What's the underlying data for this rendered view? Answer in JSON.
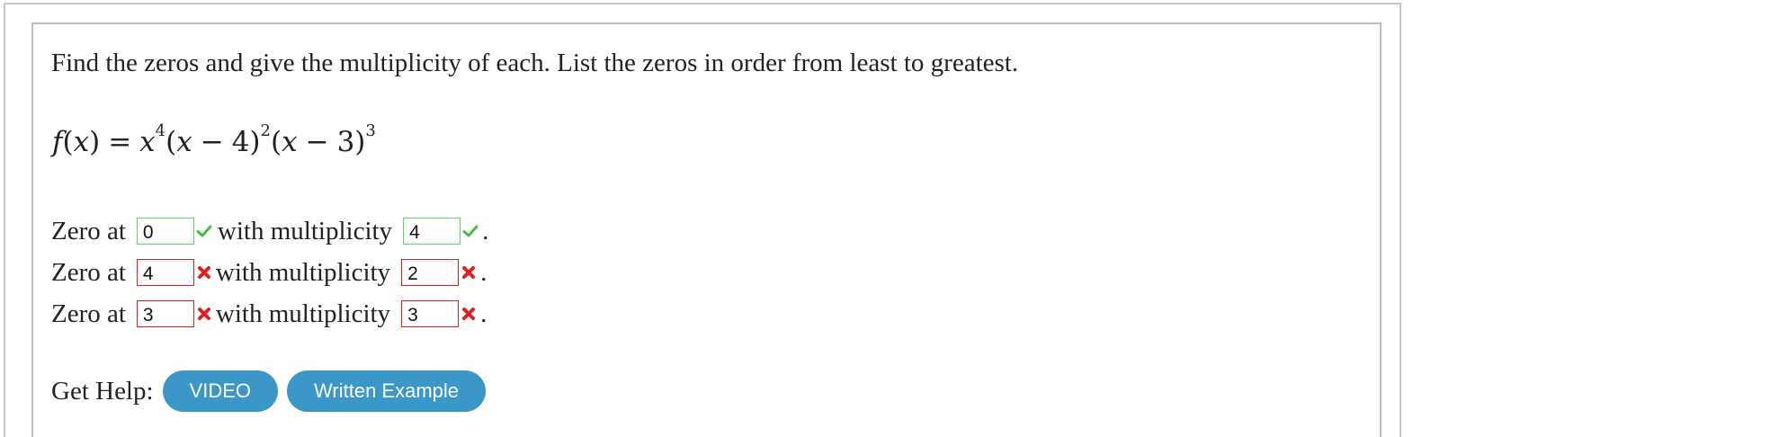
{
  "question": {
    "prompt": "Find the zeros and give the multiplicity of each. List the zeros in order from least to greatest.",
    "formula": {
      "lhs_func": "f",
      "lhs_var": "x",
      "equals": "=",
      "factor1_var": "x",
      "factor1_exp": "4",
      "factor2_var": "x",
      "factor2_op": "−",
      "factor2_const": "4",
      "factor2_exp": "2",
      "factor3_var": "x",
      "factor3_op": "−",
      "factor3_const": "3",
      "factor3_exp": "3"
    }
  },
  "answers": [
    {
      "zero_label": "Zero at",
      "zero_value": "0",
      "zero_status": "correct",
      "mult_label": "with multiplicity",
      "mult_value": "4",
      "mult_status": "correct",
      "end": "."
    },
    {
      "zero_label": "Zero at",
      "zero_value": "4",
      "zero_status": "incorrect",
      "mult_label": "with multiplicity",
      "mult_value": "2",
      "mult_status": "incorrect",
      "end": "."
    },
    {
      "zero_label": "Zero at",
      "zero_value": "3",
      "zero_status": "incorrect",
      "mult_label": "with multiplicity",
      "mult_value": "3",
      "mult_status": "incorrect",
      "end": "."
    }
  ],
  "help": {
    "label": "Get Help:",
    "video_button": "VIDEO",
    "written_button": "Written Example"
  },
  "colors": {
    "correct": "#5cd65c",
    "incorrect": "#e02020",
    "button": "#3c97c9"
  }
}
